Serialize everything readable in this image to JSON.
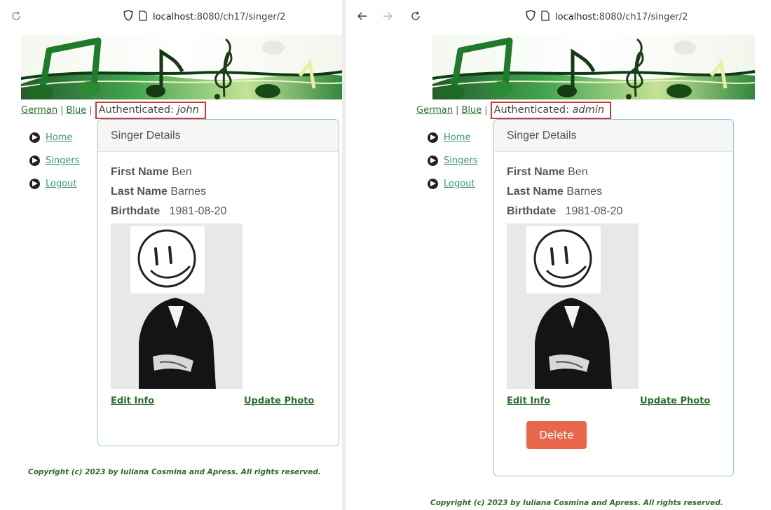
{
  "left": {
    "url_prefix": "localhost",
    "url_rest": ":8080/ch17/singer/2",
    "lang_german": "German",
    "lang_blue": "Blue",
    "auth_label": "Authenticated: ",
    "auth_user": "john",
    "nav": {
      "home": "Home",
      "singers": "Singers",
      "logout": "Logout"
    },
    "card_title": "Singer Details",
    "first_name_label": "First Name",
    "first_name": "Ben",
    "last_name_label": "Last Name",
    "last_name": "Barnes",
    "birthdate_label": "Birthdate",
    "birthdate": "1981-08-20",
    "edit_info": "Edit Info",
    "update_photo": "Update Photo",
    "copyright": "Copyright (c) 2023 by Iuliana Cosmina and Apress. All rights reserved."
  },
  "right": {
    "url_prefix": "localhost",
    "url_rest": ":8080/ch17/singer/2",
    "lang_german": "German",
    "lang_blue": "Blue",
    "auth_label": "Authenticated: ",
    "auth_user": "admin",
    "nav": {
      "home": "Home",
      "singers": "Singers",
      "logout": "Logout"
    },
    "card_title": "Singer Details",
    "first_name_label": "First Name",
    "first_name": "Ben",
    "last_name_label": "Last Name",
    "last_name": "Barnes",
    "birthdate_label": "Birthdate",
    "birthdate": "1981-08-20",
    "edit_info": "Edit Info",
    "update_photo": "Update Photo",
    "delete": "Delete",
    "copyright": "Copyright (c) 2023 by Iuliana Cosmina and Apress. All rights reserved."
  },
  "colors": {
    "link_green": "#2e6e2e",
    "nav_link": "#3a9a6a",
    "auth_border": "#d63a2f",
    "delete_button": "#e8674b",
    "card_border": "#9cc6e3"
  },
  "icons": {
    "back": "arrow-left-icon",
    "forward": "arrow-right-icon",
    "reload": "reload-icon",
    "shield": "tracking-shield-icon",
    "page": "page-icon",
    "nav_bullet": "circle-arrow-right-icon"
  }
}
